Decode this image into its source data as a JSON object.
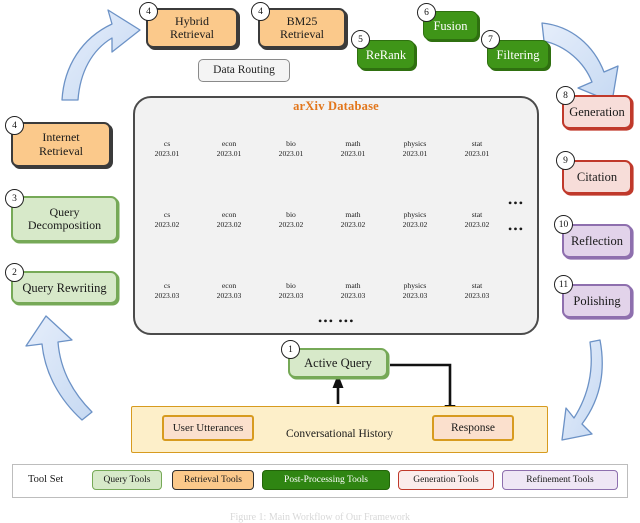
{
  "figure": {
    "database_title": "arXiv Database",
    "data_routing_label": "Data Routing",
    "toolset_label": "Tool Set",
    "conversational_history_label": "Conversational History",
    "caption": "Figure 1: Main Workflow of Our Framework"
  },
  "left_nodes": [
    {
      "num": "4",
      "label": "Internet\nRetrieval",
      "style": "orange"
    },
    {
      "num": "3",
      "label": "Query\nDecomposition",
      "style": "green-light"
    },
    {
      "num": "2",
      "label": "Query Rewriting",
      "style": "green-light"
    }
  ],
  "top_nodes": [
    {
      "num": "4",
      "label": "Hybrid\nRetrieval",
      "style": "orange"
    },
    {
      "num": "4",
      "label": "BM25\nRetrieval",
      "style": "orange"
    },
    {
      "num": "5",
      "label": "ReRank",
      "style": "green-dark"
    },
    {
      "num": "6",
      "label": "Fusion",
      "style": "green-dark"
    },
    {
      "num": "7",
      "label": "Filtering",
      "style": "green-dark"
    }
  ],
  "right_nodes": [
    {
      "num": "8",
      "label": "Generation",
      "style": "red"
    },
    {
      "num": "9",
      "label": "Citation",
      "style": "red"
    },
    {
      "num": "10",
      "label": "Reflection",
      "style": "purple"
    },
    {
      "num": "11",
      "label": "Polishing",
      "style": "purple"
    }
  ],
  "active_query": {
    "num": "1",
    "label": "Active Query",
    "style": "green-light"
  },
  "history_items": [
    {
      "label": "User Utterances"
    },
    {
      "label": "Response"
    }
  ],
  "database": {
    "columns": [
      "cs",
      "econ",
      "bio",
      "math",
      "physics",
      "stat"
    ],
    "rows": [
      "2023.01",
      "2023.02",
      "2023.03"
    ],
    "row_trailing_dots": [
      "",
      "•••",
      "•••"
    ],
    "bottom_dots": "•••  •••",
    "side_dots_extra": "•••"
  },
  "tool_set": [
    {
      "label": "Query Tools",
      "style": "c-query"
    },
    {
      "label": "Retrieval Tools",
      "style": "c-retr"
    },
    {
      "label": "Post-Processing Tools",
      "style": "c-post"
    },
    {
      "label": "Generation Tools",
      "style": "c-gen"
    },
    {
      "label": "Refinement Tools",
      "style": "c-refine"
    }
  ],
  "colors": {
    "orange_fill": "#fbc98b",
    "green_light_fill": "#d7e9c9",
    "green_dark_fill": "#3f9518",
    "red_fill": "#f7ddd9",
    "purple_fill": "#e2d3ea",
    "db_title": "#e2761b",
    "db_panel": "#f2f2f2",
    "history_fill": "#fdefc9",
    "arrow_fill": "#cfe0f5",
    "arrow_stroke": "#6c92c6",
    "cylinder_fill": "#cfdff3",
    "cylinder_stroke": "#7a9ec9"
  }
}
